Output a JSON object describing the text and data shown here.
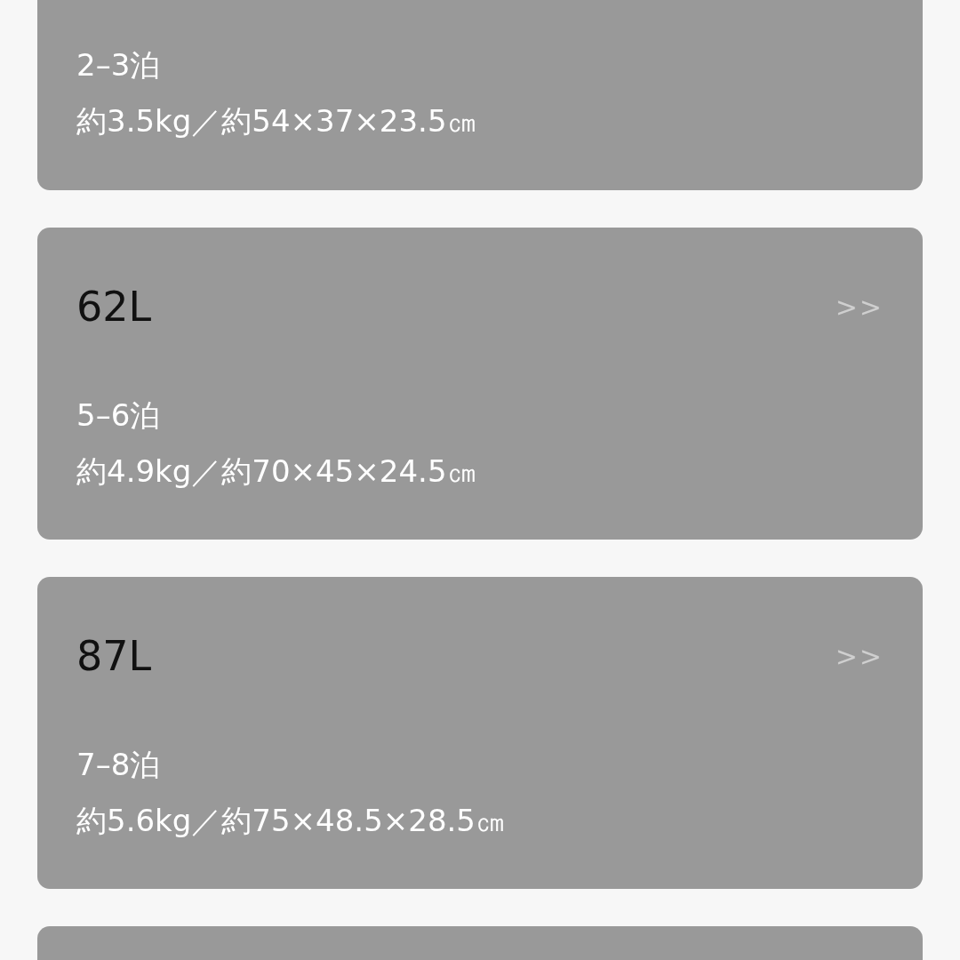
{
  "cards": [
    {
      "kind": "lower",
      "nights": "2–3泊",
      "specs": "約3.5kg／約54×37×23.5㎝"
    },
    {
      "kind": "full",
      "title": "62L",
      "arrow": ">>",
      "nights": "5–6泊",
      "specs": "約4.9kg／約70×45×24.5㎝"
    },
    {
      "kind": "full",
      "title": "87L",
      "arrow": ">>",
      "nights": "7–8泊",
      "specs": "約5.6kg／約75×48.5×28.5㎝"
    },
    {
      "kind": "top"
    }
  ]
}
